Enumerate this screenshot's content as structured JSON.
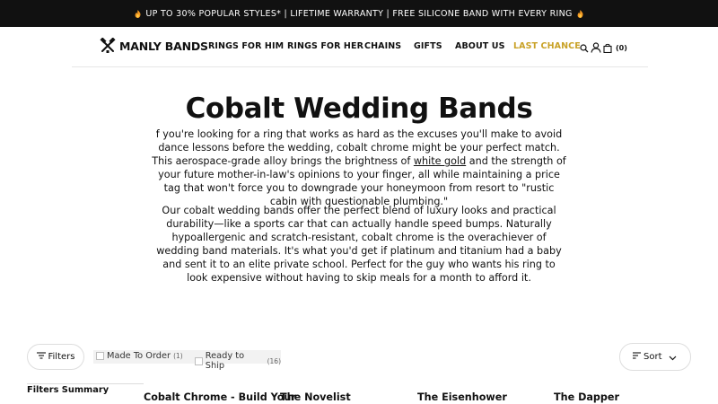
{
  "announcement": {
    "text": "UP TO 30% POPULAR STYLES* | LIFETIME WARRANTY | FREE SILICONE BAND WITH EVERY RING",
    "icon": "flame-icon"
  },
  "header": {
    "logo_text": "MANLY BANDS",
    "nav": [
      {
        "label": "RINGS FOR HIM"
      },
      {
        "label": "RINGS FOR HER"
      },
      {
        "label": "CHAINS"
      },
      {
        "label": "GIFTS"
      },
      {
        "label": "ABOUT US"
      },
      {
        "label": "LAST CHANCE"
      }
    ],
    "cart_count": "(0)",
    "accent_color": "#c9a227"
  },
  "hero": {
    "title": "Cobalt Wedding Bands",
    "para1_before": "f you're looking for a ring that works as hard as the excuses you'll make to avoid dance lessons before the wedding, cobalt chrome might be your perfect match. This aerospace-grade alloy brings the brightness of ",
    "para1_link": "white gold",
    "para1_after": " and the strength of your future mother-in-law's opinions to your finger, all while maintaining a price tag that won't force you to downgrade your honeymoon from resort to \"rustic cabin with questionable plumbing.\"",
    "para2": "Our cobalt wedding bands offer the perfect blend of luxury looks and practical durability—like a sports car that can actually handle speed bumps. Naturally hypoallergenic and scratch-resistant, cobalt chrome is the overachiever of wedding band materials. It's what you'd get if platinum and titanium had a baby and sent it to an elite private school. Perfect for the guy who wants his ring to look expensive without having to skip meals for a month to afford it."
  },
  "toolbar": {
    "filters_label": "Filters",
    "chips": [
      {
        "label": "Made To Order",
        "count": "(1)"
      },
      {
        "label": "Ready to Ship",
        "count": "(16)"
      }
    ],
    "sort_label": "Sort"
  },
  "sidebar": {
    "summary_label": "Filters Summary"
  },
  "products": [
    {
      "title": "Cobalt Chrome - Build Your"
    },
    {
      "title": "The Novelist"
    },
    {
      "title": "The Eisenhower"
    },
    {
      "title": "The Dapper"
    }
  ]
}
